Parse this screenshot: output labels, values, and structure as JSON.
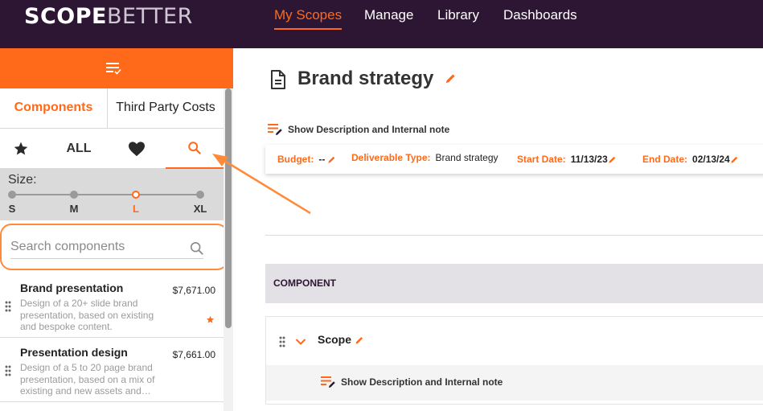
{
  "app": {
    "logo_scope": "SCOPE",
    "logo_better": "BETTER"
  },
  "nav": {
    "items": [
      {
        "label": "My Scopes",
        "active": true
      },
      {
        "label": "Manage",
        "active": false
      },
      {
        "label": "Library",
        "active": false
      },
      {
        "label": "Dashboards",
        "active": false
      }
    ]
  },
  "sidebar": {
    "header_icon": "menu-list-check-icon",
    "tabs": [
      {
        "label": "Components",
        "active": true
      },
      {
        "label": "Third Party Costs",
        "active": false
      }
    ],
    "filters": {
      "starred_icon": "star-icon",
      "all_label": "ALL",
      "favorites_icon": "heart-icon",
      "search_icon": "search-icon",
      "active": "search"
    },
    "size": {
      "label": "Size:",
      "options": [
        "S",
        "M",
        "L",
        "XL"
      ],
      "selected": "L"
    },
    "search": {
      "placeholder": "Search components",
      "value": ""
    },
    "components": [
      {
        "title": "Brand presentation",
        "price": "$7,671.00",
        "description": "Design of a 20+ slide brand presentation, based on existing and bespoke content.",
        "starred": true
      },
      {
        "title": "Presentation design",
        "price": "$7,661.00",
        "description": "Design of a 5 to 20 page brand presentation, based on a mix of existing and new assets and…",
        "starred": false
      }
    ]
  },
  "main": {
    "title": "Brand strategy",
    "show_description_label": "Show Description and Internal note",
    "meta": {
      "budget_label": "Budget:",
      "budget_value": "--",
      "deliverable_type_label": "Deliverable Type:",
      "deliverable_type_value": "Brand strategy",
      "start_date_label": "Start Date:",
      "start_date_value": "11/13/23",
      "end_date_label": "End Date:",
      "end_date_value": "02/13/24"
    },
    "component_header": "COMPONENT",
    "scope": {
      "label": "Scope",
      "show_description_label": "Show Description and Internal note"
    }
  },
  "colors": {
    "nav_bg": "#2d1633",
    "accent": "#ff6a1a",
    "annotation": "#ff8a3a"
  }
}
